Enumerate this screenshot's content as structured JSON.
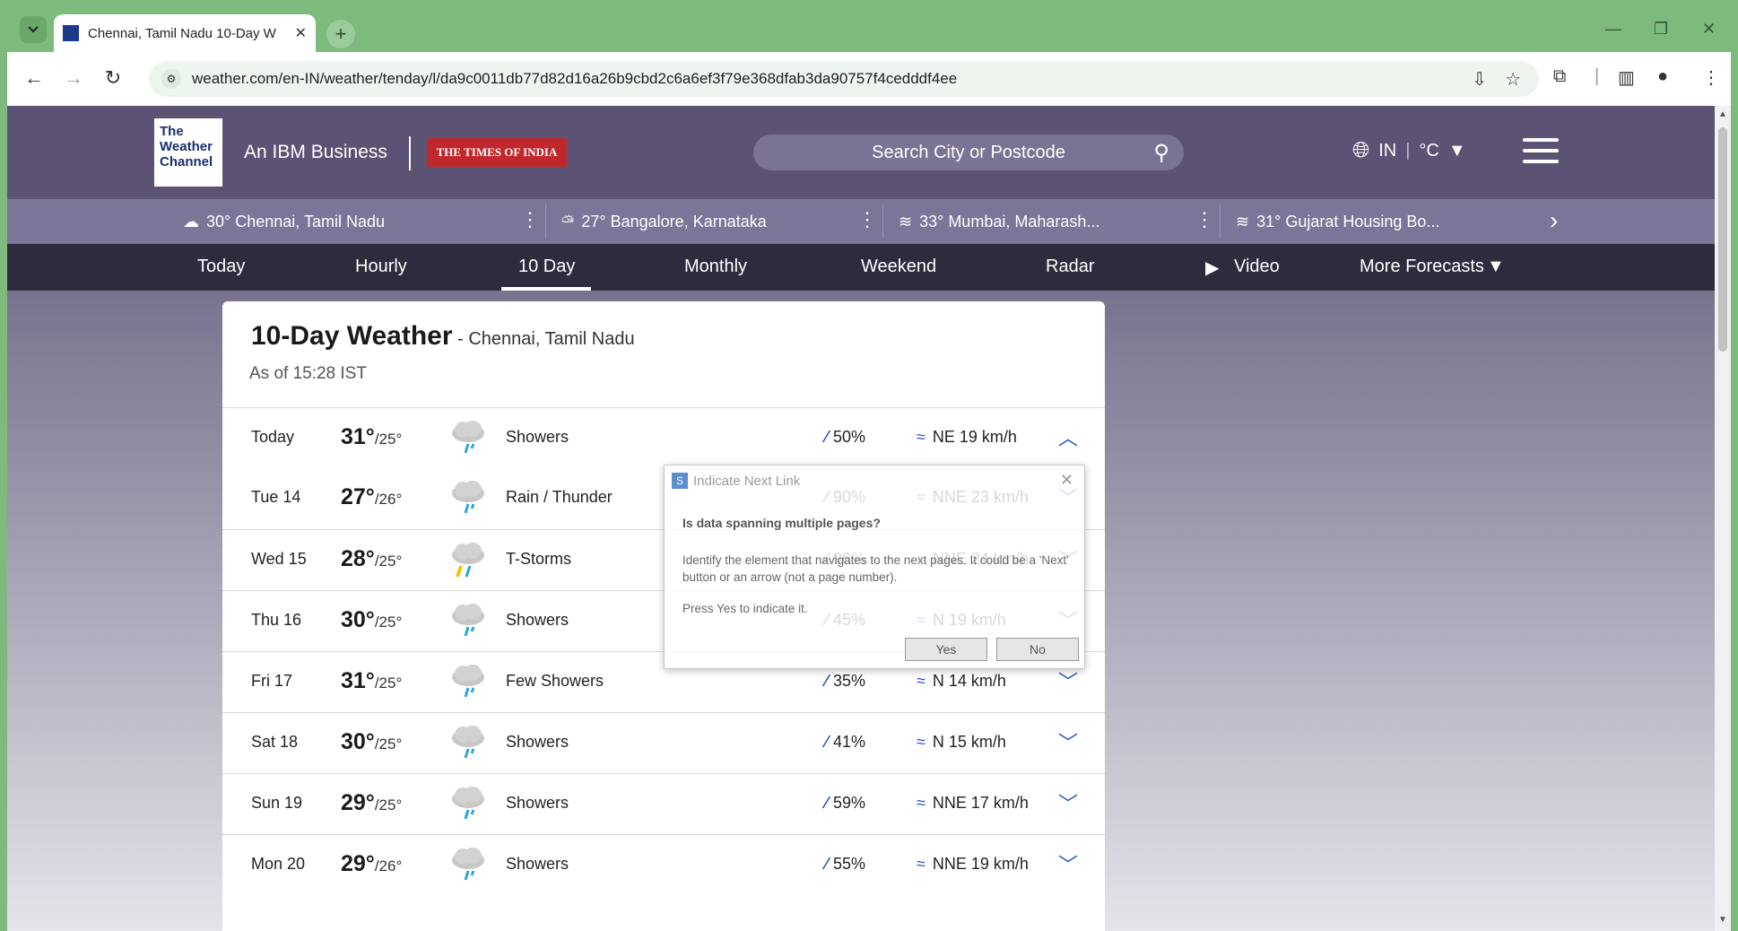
{
  "browser": {
    "tab_title": "Chennai, Tamil Nadu 10-Day W",
    "favicon_text": "The Weather Channel",
    "url": "weather.com/en-IN/weather/tenday/l/da9c0011db77d82d16a26b9cbd2c6a6ef3f79e368dfab3da90757f4cedddf4ee"
  },
  "header": {
    "logo_lines": [
      "The",
      "Weather",
      "Channel"
    ],
    "ibm_text": "An IBM Business",
    "toi_text": "THE TIMES OF INDIA",
    "search_placeholder": "Search City or Postcode",
    "country": "IN",
    "unit": "°C"
  },
  "locations": [
    {
      "text": "30° Chennai, Tamil Nadu"
    },
    {
      "text": "27° Bangalore, Karnataka"
    },
    {
      "text": "33° Mumbai, Maharash..."
    },
    {
      "text": "31° Gujarat Housing Bo..."
    }
  ],
  "nav": [
    "Today",
    "Hourly",
    "10 Day",
    "Monthly",
    "Weekend",
    "Radar",
    "Video",
    "More Forecasts"
  ],
  "card": {
    "title": "10-Day Weather",
    "location": " - Chennai, Tamil Nadu",
    "as_of": "As of 15:28 IST"
  },
  "days": [
    {
      "day": "Today",
      "hi": "31°",
      "lo": "/25°",
      "cond": "Showers",
      "precip": "50%",
      "wind": "NE 19 km/h",
      "icon": "rain"
    },
    {
      "day": "Tue 14",
      "hi": "27°",
      "lo": "/26°",
      "cond": "Rain / Thunder",
      "precip": "90%",
      "wind": "NNE 23 km/h",
      "icon": "rain"
    },
    {
      "day": "Wed 15",
      "hi": "28°",
      "lo": "/25°",
      "cond": "T-Storms",
      "precip": "96%",
      "wind": "NNE 24 km/h",
      "icon": "storm"
    },
    {
      "day": "Thu 16",
      "hi": "30°",
      "lo": "/25°",
      "cond": "Showers",
      "precip": "45%",
      "wind": "N 19 km/h",
      "icon": "rain"
    },
    {
      "day": "Fri 17",
      "hi": "31°",
      "lo": "/25°",
      "cond": "Few Showers",
      "precip": "35%",
      "wind": "N 14 km/h",
      "icon": "rain"
    },
    {
      "day": "Sat 18",
      "hi": "30°",
      "lo": "/25°",
      "cond": "Showers",
      "precip": "41%",
      "wind": "N 15 km/h",
      "icon": "rain"
    },
    {
      "day": "Sun 19",
      "hi": "29°",
      "lo": "/25°",
      "cond": "Showers",
      "precip": "59%",
      "wind": "NNE 17 km/h",
      "icon": "rain"
    },
    {
      "day": "Mon 20",
      "hi": "29°",
      "lo": "/26°",
      "cond": "Showers",
      "precip": "55%",
      "wind": "NNE 19 km/h",
      "icon": "rain"
    }
  ],
  "dialog": {
    "title": "Indicate Next Link",
    "question": "Is data spanning multiple pages?",
    "description": "Identify the element that navigates to the next pages. It could be a 'Next' button or an arrow (not a page number).",
    "press": "Press Yes to indicate it.",
    "yes": "Yes",
    "no": "No"
  }
}
